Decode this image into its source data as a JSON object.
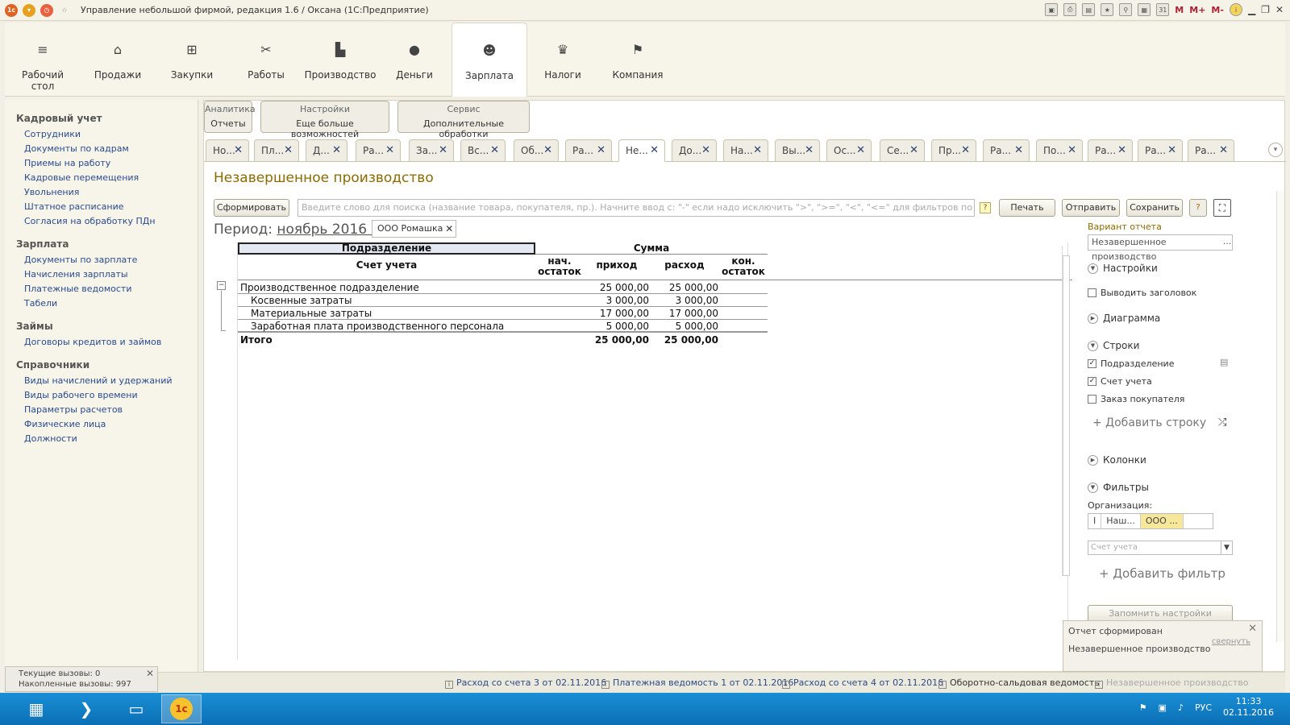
{
  "window": {
    "title": "Управление небольшой фирмой, редакция 1.6 / Оксана  (1С:Предприятие)",
    "right_buttons": [
      "M",
      "M+",
      "M-"
    ]
  },
  "sections": [
    {
      "label": "Рабочий стол",
      "icon": "menu-icon"
    },
    {
      "label": "Продажи",
      "icon": "basket-icon"
    },
    {
      "label": "Закупки",
      "icon": "cart-icon"
    },
    {
      "label": "Работы",
      "icon": "tools-icon"
    },
    {
      "label": "Производство",
      "icon": "factory-icon"
    },
    {
      "label": "Деньги",
      "icon": "money-icon"
    },
    {
      "label": "Зарплата",
      "icon": "people-icon"
    },
    {
      "label": "Налоги",
      "icon": "eagle-icon"
    },
    {
      "label": "Компания",
      "icon": "flag-icon"
    }
  ],
  "leftnav": {
    "groups": [
      {
        "title": "Кадровый учет",
        "items": [
          "Сотрудники",
          "Документы по кадрам",
          "Приемы на работу",
          "Кадровые перемещения",
          "Увольнения",
          "Штатное расписание",
          "Согласия на обработку ПДн"
        ]
      },
      {
        "title": "Зарплата",
        "items": [
          "Документы по зарплате",
          "Начисления зарплаты",
          "Платежные ведомости",
          "Табели"
        ]
      },
      {
        "title": "Займы",
        "items": [
          "Договоры кредитов и займов"
        ]
      },
      {
        "title": "Справочники",
        "items": [
          "Виды начислений и удержаний",
          "Виды рабочего времени",
          "Параметры расчетов",
          "Физические лица",
          "Должности"
        ]
      }
    ]
  },
  "command_groups": [
    {
      "title": "Аналитика",
      "button": "Отчеты"
    },
    {
      "title": "Настройки",
      "button": "Еще больше возможностей"
    },
    {
      "title": "Сервис",
      "button": "Дополнительные обработки"
    }
  ],
  "tabs": [
    "Но...",
    "Пл...",
    "Д...",
    "Ра...",
    "За...",
    "Вс...",
    "Об...",
    "Ра...",
    "Не...",
    "До...",
    "На...",
    "Вы...",
    "Ос...",
    "Се...",
    "Пр...",
    "Ра...",
    "По...",
    "Ра...",
    "Ра...",
    "Ра..."
  ],
  "active_tab": 8,
  "form": {
    "title": "Незавершенное производство",
    "generate_button": "Сформировать",
    "search_placeholder": "Введите слово для поиска (название товара, покупателя, пр.). Начните ввод с: \"-\" если надо исключить \">\", \">=\", \"<\", \"<=\" для фильтров по числам и датам Возможн...",
    "print_button": "Печать",
    "send_button": "Отправить",
    "save_button": "Сохранить",
    "period_label": "Период:",
    "period_value": "ноябрь 2016 г.",
    "org_chip": "ООО Ромашка"
  },
  "report": {
    "header_dept": "Подразделение",
    "header_sum": "Сумма",
    "header_account": "Счет учета",
    "col_open": "нач. остаток",
    "col_in": "приход",
    "col_out": "расход",
    "col_close": "кон. остаток",
    "rows": [
      {
        "name": "Производственное подразделение",
        "in": "25 000,00",
        "out": "25 000,00",
        "level": 0
      },
      {
        "name": "Косвенные затраты",
        "in": "3 000,00",
        "out": "3 000,00",
        "level": 1
      },
      {
        "name": "Материальные затраты",
        "in": "17 000,00",
        "out": "17 000,00",
        "level": 1
      },
      {
        "name": "Заработная плата производственного персонала",
        "in": "5 000,00",
        "out": "5 000,00",
        "level": 1
      }
    ],
    "total": {
      "name": "Итого",
      "in": "25 000,00",
      "out": "25 000,00"
    }
  },
  "settings": {
    "variant_title": "Вариант отчета",
    "variant_value": "Незавершенное производство",
    "group_settings": "Настройки",
    "show_header": "Выводить заголовок",
    "group_chart": "Диаграмма",
    "group_rows": "Строки",
    "row_dept": "Подразделение",
    "row_account": "Счет учета",
    "row_order": "Заказ покупателя",
    "add_row": "+ Добавить строку",
    "group_columns": "Колонки",
    "group_filters": "Фильтры",
    "org_label": "Организация:",
    "org_seg": [
      "I",
      "Наш...",
      "ООО ..."
    ],
    "account_placeholder": "Счет учета",
    "add_filter": "+ Добавить фильтр",
    "remember_button": "Запомнить настройки"
  },
  "calls": {
    "current": "Текущие вызовы: 0",
    "accum": "Накопленные вызовы: 997"
  },
  "history": [
    "Расход со счета 3 от 02.11.2016",
    "Платежная ведомость 1 от 02.11.2016",
    "Расход со счета 4 от 02.11.2016",
    "Оборотно-сальдовая ведомость",
    "Незавершенное производство"
  ],
  "notification": {
    "title": "Отчет сформирован",
    "hide": "свернуть",
    "body": "Незавершенное производство"
  },
  "taskbar": {
    "lang": "РУС",
    "time": "11:33",
    "date": "02.11.2016"
  }
}
